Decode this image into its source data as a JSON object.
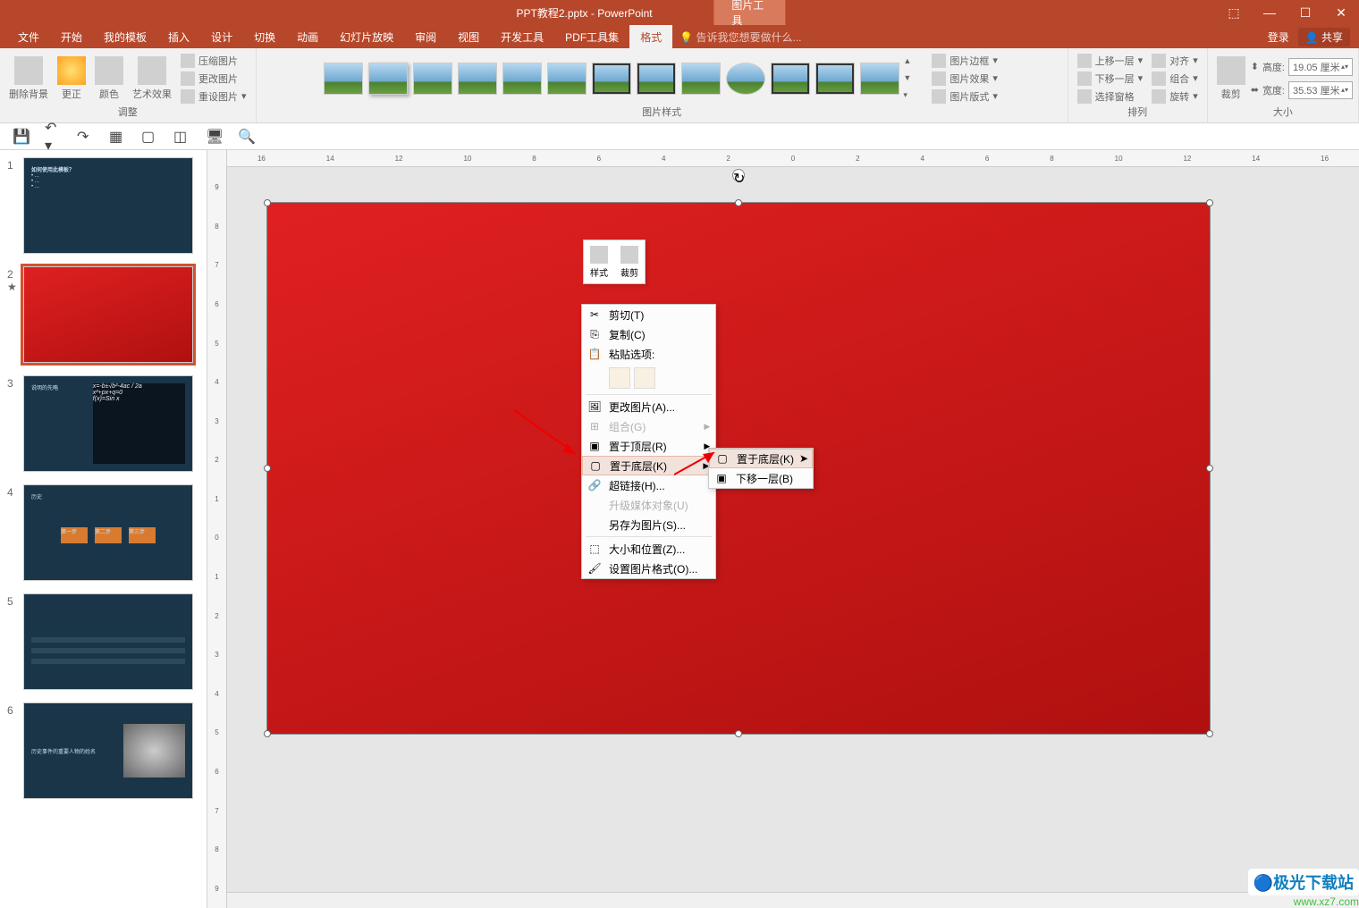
{
  "titlebar": {
    "title": "PPT教程2.pptx - PowerPoint",
    "context_tab": "图片工具",
    "login": "登录",
    "share": "共享"
  },
  "menu": {
    "tabs": [
      "文件",
      "开始",
      "我的模板",
      "插入",
      "设计",
      "切换",
      "动画",
      "幻灯片放映",
      "审阅",
      "视图",
      "开发工具",
      "PDF工具集",
      "格式"
    ],
    "active": "格式",
    "tellme": "告诉我您想要做什么..."
  },
  "ribbon": {
    "group_adjust": {
      "label": "调整",
      "remove_bg": "删除背景",
      "corrections": "更正",
      "color": "颜色",
      "artistic": "艺术效果",
      "compress": "压缩图片",
      "change": "更改图片",
      "reset": "重设图片"
    },
    "group_styles": {
      "label": "图片样式"
    },
    "group_border": {
      "border": "图片边框",
      "effects": "图片效果",
      "layout": "图片版式"
    },
    "group_arrange": {
      "label": "排列",
      "bring_fwd": "上移一层",
      "send_back": "下移一层",
      "selection_pane": "选择窗格",
      "align": "对齐",
      "group": "组合",
      "rotate": "旋转"
    },
    "group_size": {
      "label": "大小",
      "crop": "裁剪",
      "height_label": "高度:",
      "height": "19.05 厘米",
      "width_label": "宽度:",
      "width": "35.53 厘米"
    }
  },
  "mini_toolbar": {
    "style": "样式",
    "crop": "裁剪"
  },
  "context_menu": {
    "cut": "剪切(T)",
    "copy": "复制(C)",
    "paste_options": "粘贴选项:",
    "change_picture": "更改图片(A)...",
    "group": "组合(G)",
    "bring_front": "置于顶层(R)",
    "send_back": "置于底层(K)",
    "hyperlink": "超链接(H)...",
    "upgrade_media": "升级媒体对象(U)",
    "save_as_picture": "另存为图片(S)...",
    "size_position": "大小和位置(Z)...",
    "format_picture": "设置图片格式(O)..."
  },
  "submenu": {
    "send_to_back": "置于底层(K)",
    "send_backward": "下移一层(B)"
  },
  "thumbs": {
    "slides": [
      1,
      2,
      3,
      4,
      5,
      6
    ],
    "active": 2,
    "slide1_title": "如何使用此模板？",
    "slide3_title": "说明的先略",
    "slide4_title": "历史",
    "slide4_steps": [
      "第一步",
      "第二步",
      "第三步"
    ],
    "slide6_title": "历史事件的重要人物的姓名"
  },
  "ruler": {
    "h_ticks": [
      "16",
      "14",
      "12",
      "10",
      "8",
      "6",
      "4",
      "2",
      "0",
      "2",
      "4",
      "6",
      "8",
      "10",
      "12",
      "14",
      "16"
    ],
    "v_ticks": [
      "9",
      "8",
      "7",
      "6",
      "5",
      "4",
      "3",
      "2",
      "1",
      "0",
      "1",
      "2",
      "3",
      "4",
      "5",
      "6",
      "7",
      "8",
      "9"
    ]
  },
  "watermark": {
    "logo": "极光下载站",
    "url": "www.xz7.com"
  },
  "window_controls": {
    "restore": "⬜",
    "min": "—",
    "max": "☐",
    "close": "✕",
    "opts": "▾"
  }
}
